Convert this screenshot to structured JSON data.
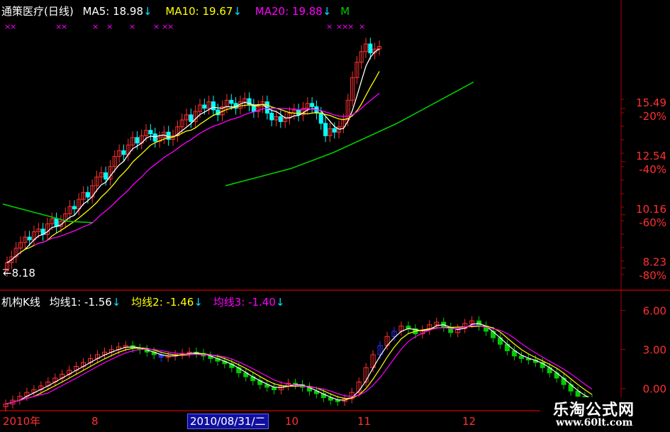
{
  "main": {
    "title": "通策医疗(日线)",
    "ma5_label": "MA5: 18.98",
    "ma10_label": "MA10: 19.67",
    "ma20_label": "MA20: 19.88",
    "extra_label": "M",
    "arrow": "↓",
    "marker": "×",
    "low_label": "←8.18",
    "price_ticks": [
      "15.49",
      "12.54",
      "10.16",
      "8.23"
    ],
    "pct_ticks": [
      "-20%",
      "-40%",
      "-60%",
      "-80%"
    ]
  },
  "sub": {
    "title": "机构K线",
    "line1_label": "均线1: -1.56",
    "line2_label": "均线2: -1.46",
    "line3_label": "均线3: -1.40",
    "arrow": "↓",
    "ticks": [
      "6.00",
      "3.00",
      "0.00"
    ]
  },
  "xaxis": {
    "labels": [
      "2010年",
      "8",
      "10",
      "11",
      "12"
    ],
    "cursor_date": "2010/08/31/二"
  },
  "watermark": {
    "name": "乐淘公式网",
    "url": "www.60lt.com"
  },
  "colors": {
    "up": "#ff3030",
    "down": "#00ffff",
    "ma5": "#ffffff",
    "ma10": "#ffff00",
    "ma20": "#ff00ff",
    "ma_long": "#00cc00",
    "axis": "#b00000",
    "sub_down": "#00cc00",
    "sub_blue": "#3030ff"
  },
  "chart_data": [
    {
      "type": "candlestick",
      "title": "通策医疗(日线)",
      "yscale": "log",
      "yticks": [
        15.49,
        12.54,
        10.16,
        8.23
      ],
      "ylim": [
        7.6,
        20.8
      ],
      "x_period": [
        "2010年",
        "12"
      ],
      "low_marker": 8.18,
      "series": [
        {
          "name": "MA5",
          "value": 18.98
        },
        {
          "name": "MA10",
          "value": 19.67
        },
        {
          "name": "MA20",
          "value": 19.88
        }
      ],
      "close": [
        8.4,
        8.6,
        8.9,
        9.1,
        9.3,
        9.2,
        9.5,
        9.6,
        9.4,
        9.8,
        10.0,
        9.7,
        9.9,
        10.2,
        10.5,
        10.4,
        10.8,
        11.1,
        10.9,
        11.4,
        11.8,
        12.0,
        11.7,
        12.3,
        12.8,
        13.1,
        12.9,
        13.4,
        13.8,
        13.5,
        13.9,
        14.2,
        14.0,
        13.6,
        13.8,
        14.1,
        13.7,
        13.9,
        14.4,
        14.8,
        15.1,
        14.7,
        15.3,
        15.7,
        15.5,
        15.9,
        15.4,
        15.1,
        15.6,
        16.0,
        15.8,
        15.5,
        15.9,
        16.1,
        15.7,
        15.3,
        15.6,
        15.9,
        15.2,
        14.8,
        15.0,
        14.7,
        14.9,
        15.2,
        15.4,
        15.1,
        15.5,
        15.8,
        15.6,
        15.2,
        14.6,
        13.9,
        14.3,
        14.1,
        14.4,
        14.8,
        16.0,
        17.5,
        18.6,
        19.4,
        20.0,
        19.3,
        19.6,
        19.8
      ]
    },
    {
      "type": "candlestick",
      "title": "机构K线",
      "yticks": [
        6.0,
        3.0,
        0.0
      ],
      "ylim": [
        -1.6,
        7.4
      ],
      "x_period": [
        "2010年",
        "12"
      ],
      "series": [
        {
          "name": "均线1",
          "value": -1.56
        },
        {
          "name": "均线2",
          "value": -1.46
        },
        {
          "name": "均线3",
          "value": -1.4
        }
      ],
      "values": [
        -1.2,
        -0.9,
        -0.6,
        -0.3,
        -0.1,
        0.2,
        0.5,
        0.8,
        1.1,
        1.4,
        1.7,
        2.0,
        2.3,
        2.6,
        2.8,
        3.0,
        3.2,
        3.3,
        3.1,
        3.0,
        2.8,
        2.6,
        2.4,
        2.5,
        2.6,
        2.7,
        2.8,
        2.7,
        2.5,
        2.3,
        2.1,
        1.9,
        1.6,
        1.2,
        0.9,
        0.6,
        0.3,
        0.1,
        -0.1,
        0.2,
        0.4,
        0.3,
        0.1,
        -0.2,
        -0.4,
        -0.7,
        -0.9,
        -1.0,
        -0.8,
        -0.3,
        0.5,
        1.6,
        2.6,
        3.3,
        4.0,
        4.4,
        4.8,
        4.6,
        4.2,
        4.5,
        4.9,
        5.1,
        4.7,
        4.3,
        4.6,
        5.0,
        5.2,
        4.8,
        4.4,
        3.9,
        3.4,
        2.9,
        2.5,
        2.3,
        2.2,
        2.0,
        1.6,
        1.2,
        0.8,
        0.3,
        -0.2,
        -0.6,
        -0.8,
        -1.0
      ]
    }
  ]
}
